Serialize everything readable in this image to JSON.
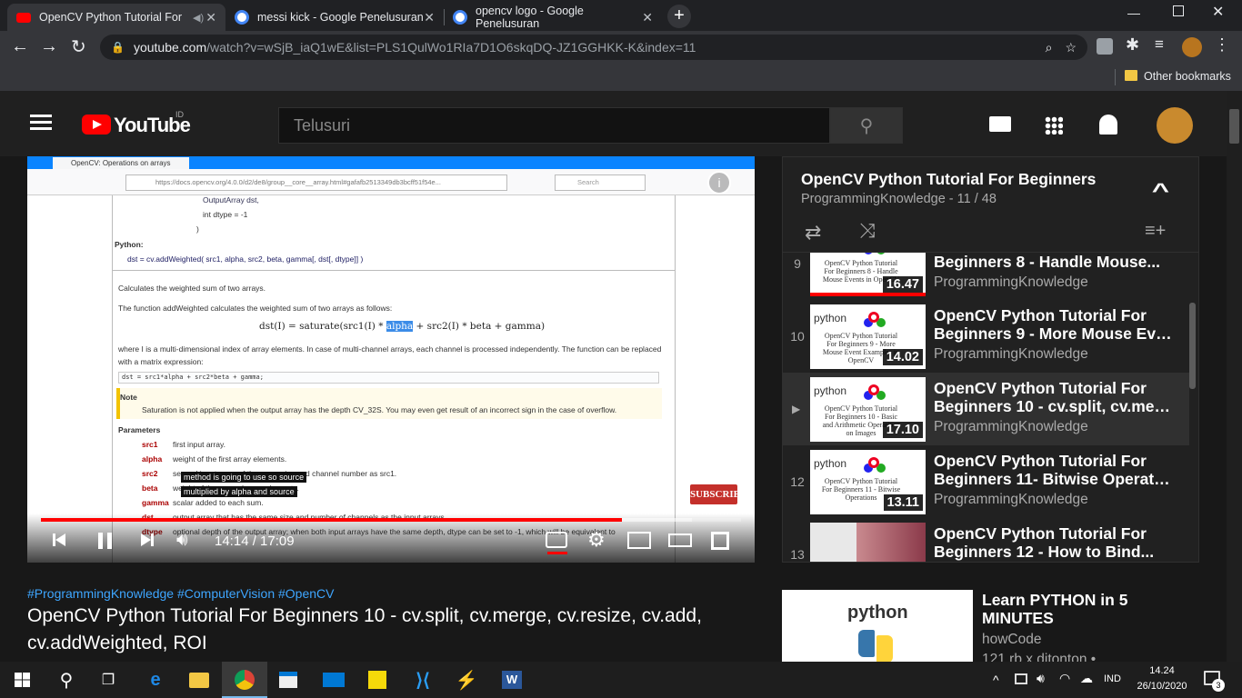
{
  "browser": {
    "tabs": [
      {
        "title": "OpenCV Python Tutorial For",
        "active": true
      },
      {
        "title": "messi kick - Google Penelusuran",
        "active": false
      },
      {
        "title": "opencv logo - Google Penelusuran",
        "active": false
      }
    ],
    "url_domain": "youtube.com",
    "url_path": "/watch?v=wSjB_iaQ1wE&list=PLS1QulWo1RIa7D1O6skqDQ-JZ1GGHKK-K&index=11",
    "bookmarks_other": "Other bookmarks"
  },
  "youtube": {
    "logo_text": "YouTube",
    "region": "ID",
    "search_placeholder": "Telusuri"
  },
  "video": {
    "time": "14:14 / 17:09",
    "progress": 0.83,
    "buffered": 0.93,
    "hashtags": "#ProgrammingKnowledge #ComputerVision #OpenCV",
    "title": "OpenCV Python Tutorial For Beginners 10 - cv.split, cv.merge, cv.resize, cv.add, cv.addWeighted, ROI",
    "subscribe_label": "SUBSCRIBE",
    "captions": [
      "method is going to use so source",
      "multiplied by alpha and source"
    ],
    "frame": {
      "browser_tab": "OpenCV: Operations on arrays",
      "browser_url": "https://docs.opencv.org/4.0.0/d2/de8/group__core__array.html#gafafb2513349db3bcff51f54e...",
      "browser_search": "Search",
      "code_line1": "OutputArray  dst,",
      "code_line2": "int              dtype = -1",
      "code_line3": ")",
      "python_label": "Python:",
      "python_sig": "dst = cv.addWeighted( src1, alpha, src2, beta, gamma[, dst[, dtype]] )",
      "desc1": "Calculates the weighted sum of two arrays.",
      "desc2": "The function addWeighted calculates the weighted sum of two arrays as follows:",
      "formula_pre": "dst(I) = saturate(src1(I) * ",
      "formula_alpha": "alpha",
      "formula_post": " + src2(I) * beta + gamma)",
      "desc3": "where I is a multi-dimensional index of array elements. In case of multi-channel arrays, each channel is processed independently. The function can be replaced with a matrix expression:",
      "code_expr": "dst = src1*alpha + src2*beta + gamma;",
      "note_label": "Note",
      "note_text": "Saturation is not applied when the output array has the depth CV_32S. You may even get result of an incorrect sign in the case of overflow.",
      "params_label": "Parameters",
      "params": [
        {
          "name": "src1",
          "desc": "first input array."
        },
        {
          "name": "alpha",
          "desc": "weight of the first array elements."
        },
        {
          "name": "src2",
          "desc": "second input array of the same size and channel number as src1."
        },
        {
          "name": "beta",
          "desc": "weight of the second array elements."
        },
        {
          "name": "gamma",
          "desc": "scalar added to each sum."
        },
        {
          "name": "dst",
          "desc": "output array that has the same size and number of channels as the input arrays."
        },
        {
          "name": "dtype",
          "desc": "optional depth of the output array; when both input arrays have the same depth, dtype can be set to -1, which will be equivalent to"
        }
      ]
    }
  },
  "playlist": {
    "title": "OpenCV Python Tutorial For Beginners",
    "channel_pos": "ProgrammingKnowledge - 11 / 48",
    "items": [
      {
        "index": "9",
        "title": "Beginners 8 - Handle Mouse...",
        "title2": "",
        "channel": "ProgrammingKnowledge",
        "duration": "16.47",
        "thumb_text": "OpenCV Python Tutorial For Beginners 8 - Handle Mouse Events in OpenCV"
      },
      {
        "index": "10",
        "title": "OpenCV Python Tutorial For",
        "title2": "Beginners 9 - More Mouse Even...",
        "channel": "ProgrammingKnowledge",
        "duration": "14.02",
        "thumb_text": "OpenCV Python Tutorial For Beginners 9 - More Mouse Event Examples in OpenCV"
      },
      {
        "index": "",
        "title": "OpenCV Python Tutorial For",
        "title2": "Beginners 10 - cv.split, cv.merg...",
        "channel": "ProgrammingKnowledge",
        "duration": "17.10",
        "thumb_text": "OpenCV Python Tutorial For Beginners 10 - Basic and Arithmetic Operations on Images"
      },
      {
        "index": "12",
        "title": "OpenCV Python Tutorial For",
        "title2": "Beginners 11- Bitwise Operatio...",
        "channel": "ProgrammingKnowledge",
        "duration": "13.11",
        "thumb_text": "OpenCV Python Tutorial For Beginners 11 - Bitwise Operations"
      },
      {
        "index": "13",
        "title": "OpenCV Python Tutorial For",
        "title2": "Beginners 12 - How to Bind...",
        "channel": "",
        "duration": "",
        "thumb_text": ""
      }
    ]
  },
  "suggested": {
    "thumb_label": "python",
    "title": "Learn PYTHON in 5 MINUTES",
    "channel": "howCode",
    "views": "121 rb x ditonton •"
  },
  "taskbar": {
    "language": "IND",
    "time": "14.24",
    "date": "26/10/2020",
    "notifications": "3"
  },
  "colors": {
    "yt_red": "#ff0000",
    "link_blue": "#3ea6ff",
    "chrome_dark": "#202124"
  }
}
